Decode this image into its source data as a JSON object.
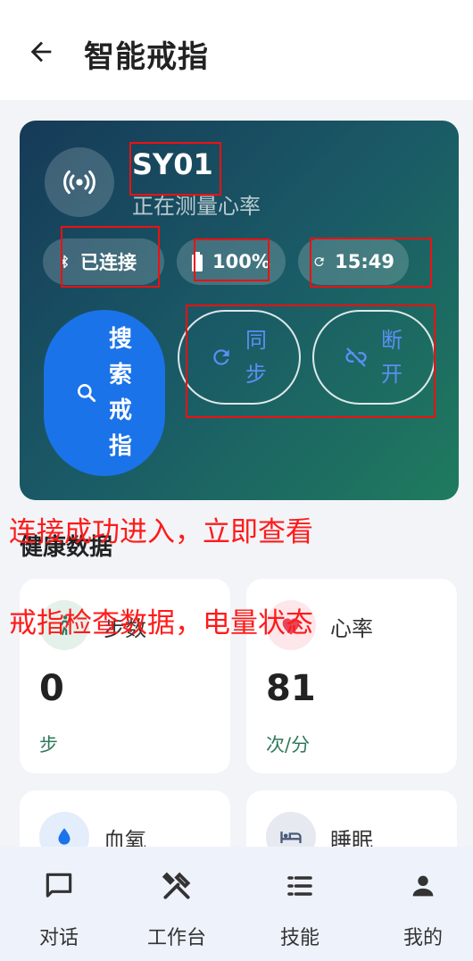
{
  "appbar": {
    "title": "智能戒指"
  },
  "device": {
    "name": "SY01",
    "status": "正在测量心率",
    "connection": "已连接",
    "battery": "100%",
    "time": "15:49"
  },
  "actions": {
    "search": "搜索戒指",
    "sync": "同步",
    "disconnect": "断开"
  },
  "health": {
    "section_title": "健康数据",
    "tiles": [
      {
        "label": "步数",
        "value": "0",
        "unit": "步"
      },
      {
        "label": "心率",
        "value": "81",
        "unit": "次/分"
      },
      {
        "label": "血氧"
      },
      {
        "label": "睡眠"
      }
    ]
  },
  "annotations": {
    "line1": "连接成功进入，立即查看",
    "line2": "戒指检查数据，电量状态"
  },
  "bottom_nav": [
    {
      "label": "对话"
    },
    {
      "label": "工作台"
    },
    {
      "label": "技能"
    },
    {
      "label": "我的"
    }
  ],
  "colors": {
    "primary": "#1a73e8",
    "annotation": "#ff1a1a",
    "unit_green": "#2f7a5c"
  }
}
